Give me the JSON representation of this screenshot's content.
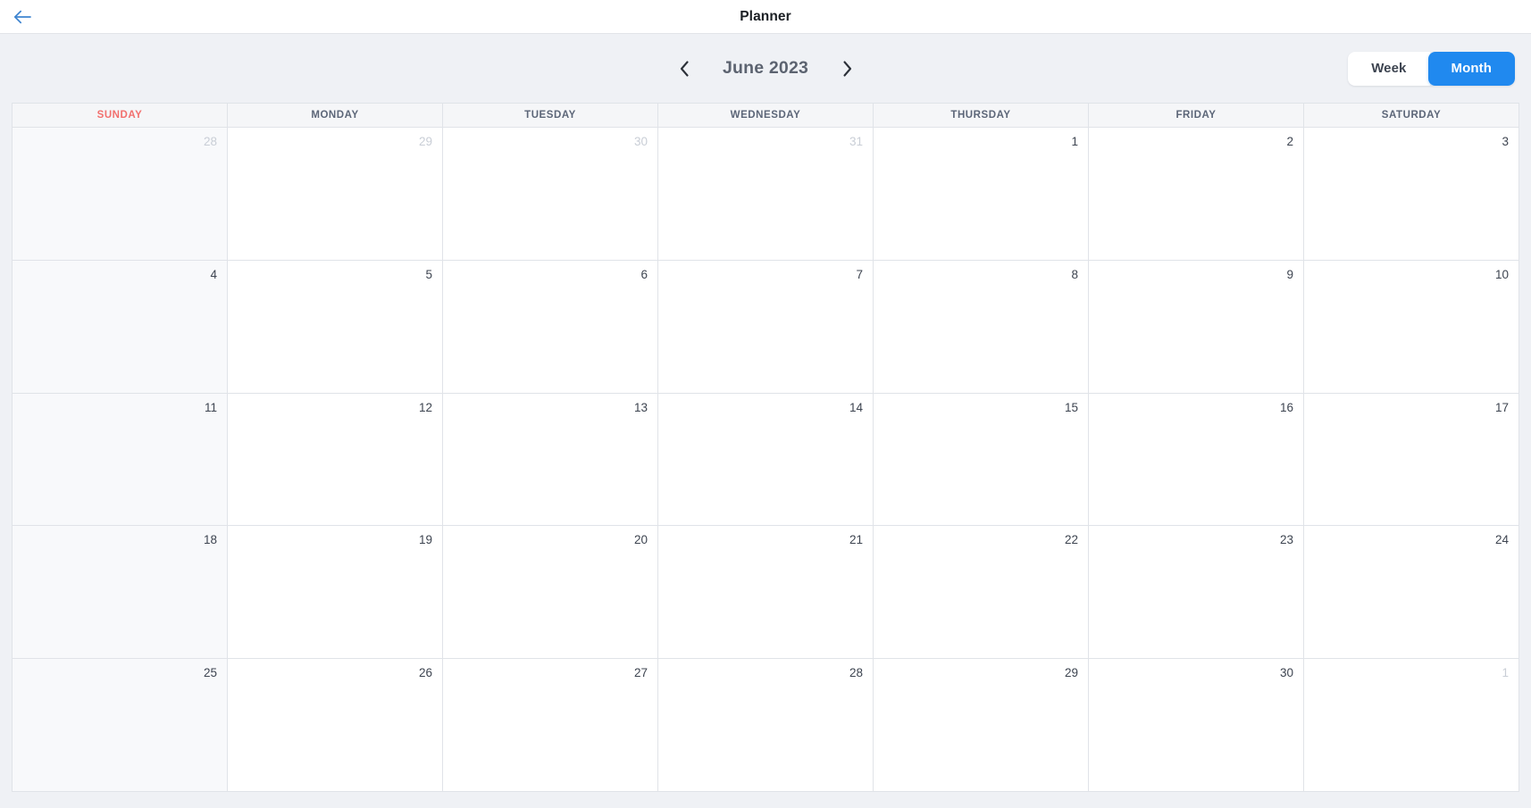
{
  "topbar": {
    "back_icon": "arrow-left-icon",
    "title": "Planner"
  },
  "toolbar": {
    "prev_icon": "chevron-left-icon",
    "next_icon": "chevron-right-icon",
    "month_label": "June 2023",
    "views": [
      {
        "label": "Week",
        "active": false
      },
      {
        "label": "Month",
        "active": true
      }
    ]
  },
  "colors": {
    "accent_blue": "#2089ef",
    "sunday_red": "#f2706e",
    "header_text": "#5c6678",
    "day_text": "#3d4450",
    "muted_day_text": "#c9ced6",
    "grid_line": "#e0e3e8",
    "page_bg": "#eff1f5",
    "sunday_column_bg": "#f8f9fb",
    "dow_header_bg": "#f5f6f8"
  },
  "calendar": {
    "day_headers": [
      {
        "label": "SUNDAY",
        "highlight": true
      },
      {
        "label": "MONDAY",
        "highlight": false
      },
      {
        "label": "TUESDAY",
        "highlight": false
      },
      {
        "label": "WEDNESDAY",
        "highlight": false
      },
      {
        "label": "THURSDAY",
        "highlight": false
      },
      {
        "label": "FRIDAY",
        "highlight": false
      },
      {
        "label": "SATURDAY",
        "highlight": false
      }
    ],
    "weeks": [
      [
        {
          "day": "28",
          "muted": true
        },
        {
          "day": "29",
          "muted": true
        },
        {
          "day": "30",
          "muted": true
        },
        {
          "day": "31",
          "muted": true
        },
        {
          "day": "1",
          "muted": false
        },
        {
          "day": "2",
          "muted": false
        },
        {
          "day": "3",
          "muted": false
        }
      ],
      [
        {
          "day": "4",
          "muted": false
        },
        {
          "day": "5",
          "muted": false
        },
        {
          "day": "6",
          "muted": false
        },
        {
          "day": "7",
          "muted": false
        },
        {
          "day": "8",
          "muted": false
        },
        {
          "day": "9",
          "muted": false
        },
        {
          "day": "10",
          "muted": false
        }
      ],
      [
        {
          "day": "11",
          "muted": false
        },
        {
          "day": "12",
          "muted": false
        },
        {
          "day": "13",
          "muted": false
        },
        {
          "day": "14",
          "muted": false
        },
        {
          "day": "15",
          "muted": false
        },
        {
          "day": "16",
          "muted": false
        },
        {
          "day": "17",
          "muted": false
        }
      ],
      [
        {
          "day": "18",
          "muted": false
        },
        {
          "day": "19",
          "muted": false
        },
        {
          "day": "20",
          "muted": false
        },
        {
          "day": "21",
          "muted": false
        },
        {
          "day": "22",
          "muted": false
        },
        {
          "day": "23",
          "muted": false
        },
        {
          "day": "24",
          "muted": false
        }
      ],
      [
        {
          "day": "25",
          "muted": false
        },
        {
          "day": "26",
          "muted": false
        },
        {
          "day": "27",
          "muted": false
        },
        {
          "day": "28",
          "muted": false
        },
        {
          "day": "29",
          "muted": false
        },
        {
          "day": "30",
          "muted": false
        },
        {
          "day": "1",
          "muted": true
        }
      ]
    ]
  }
}
